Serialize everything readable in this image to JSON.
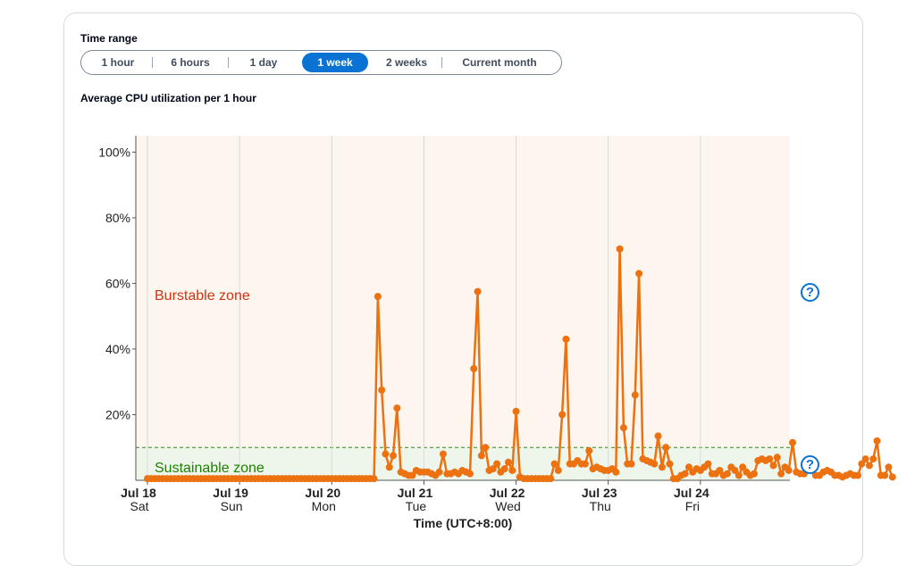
{
  "time_range": {
    "label": "Time range",
    "options": [
      "1 hour",
      "6 hours",
      "1 day",
      "1 week",
      "2 weeks",
      "Current month"
    ],
    "selected": "1 week"
  },
  "chart_title": "Average CPU utilization per 1 hour",
  "colors": {
    "series": "#ec7211",
    "burst_zone_text": "#d13212",
    "sustain_zone_text": "#1d8102",
    "burst_bg": "#fdf6ee",
    "sustain_bg": "#eef6ec",
    "accent": "#0972d3"
  },
  "chart_data": {
    "type": "line",
    "title": "Average CPU utilization per 1 hour",
    "xlabel": "Time (UTC+8:00)",
    "ylabel": "",
    "ylim": [
      0,
      105
    ],
    "y_ticks": [
      "20%",
      "40%",
      "60%",
      "80%",
      "100%"
    ],
    "y_tick_values": [
      20,
      40,
      60,
      80,
      100
    ],
    "x_ticks": [
      {
        "date": "Jul 18",
        "day": "Sat"
      },
      {
        "date": "Jul 19",
        "day": "Sun"
      },
      {
        "date": "Jul 20",
        "day": "Mon"
      },
      {
        "date": "Jul 21",
        "day": "Tue"
      },
      {
        "date": "Jul 22",
        "day": "Wed"
      },
      {
        "date": "Jul 23",
        "day": "Thu"
      },
      {
        "date": "Jul 24",
        "day": "Fri"
      }
    ],
    "zones": [
      {
        "name": "Burstable zone",
        "from": 10,
        "to": 105
      },
      {
        "name": "Sustainable zone",
        "from": 0,
        "to": 10
      }
    ],
    "sustainable_threshold": 10,
    "series": [
      {
        "x_start": "Jul 18 00:00",
        "interval": "1 hour",
        "values": [
          0.5,
          0.5,
          0.5,
          0.5,
          0.5,
          0.5,
          0.5,
          0.5,
          0.5,
          0.5,
          0.5,
          0.5,
          0.5,
          0.5,
          0.5,
          0.5,
          0.5,
          0.5,
          0.5,
          0.5,
          0.5,
          0.5,
          0.5,
          0.5,
          0.5,
          0.5,
          0.5,
          0.5,
          0.5,
          0.5,
          0.5,
          0.5,
          0.5,
          0.5,
          0.5,
          0.5,
          0.5,
          0.5,
          0.5,
          0.5,
          0.5,
          0.5,
          0.5,
          0.5,
          0.5,
          0.5,
          0.5,
          0.5,
          0.5,
          0.5,
          0.5,
          0.5,
          0.5,
          0.5,
          0.5,
          0.5,
          0.5,
          0.5,
          0.5,
          0.5,
          56,
          27.5,
          8,
          4,
          7.5,
          22,
          2.5,
          2,
          1.5,
          1.5,
          3,
          2.5,
          2.5,
          2.5,
          2,
          1.5,
          2.5,
          8,
          2,
          2,
          2.5,
          2,
          3,
          2.5,
          2,
          34,
          57.5,
          7.5,
          10,
          3,
          3.5,
          5,
          2.5,
          3.5,
          5.5,
          3,
          21,
          1,
          0.5,
          0.5,
          0.5,
          0.5,
          0.5,
          0.5,
          0.5,
          0.5,
          5,
          3,
          20,
          43,
          5,
          5,
          6,
          5,
          5,
          9,
          3.5,
          4,
          3.5,
          3,
          3,
          3.5,
          2.5,
          70.5,
          16,
          5,
          5,
          26,
          63,
          6.5,
          6,
          5.5,
          5,
          13.5,
          4,
          10,
          5,
          0.5,
          0.5,
          1.5,
          2,
          4,
          2.5,
          3.5,
          3,
          4,
          5,
          2,
          2,
          3,
          1.5,
          2,
          4,
          3,
          1.5,
          4,
          2.5,
          1.5,
          2,
          6,
          6.5,
          6,
          6.5,
          4.5,
          7,
          2,
          4,
          3,
          11.5,
          2.5,
          2,
          2,
          4,
          3,
          1.5,
          1.5,
          2.5,
          3,
          2.5,
          1.5,
          1.5,
          1,
          1.5,
          2,
          1.5,
          1.5,
          5,
          6.5,
          4.5,
          6.5,
          12,
          1.5,
          1.5,
          4,
          1
        ]
      }
    ]
  }
}
